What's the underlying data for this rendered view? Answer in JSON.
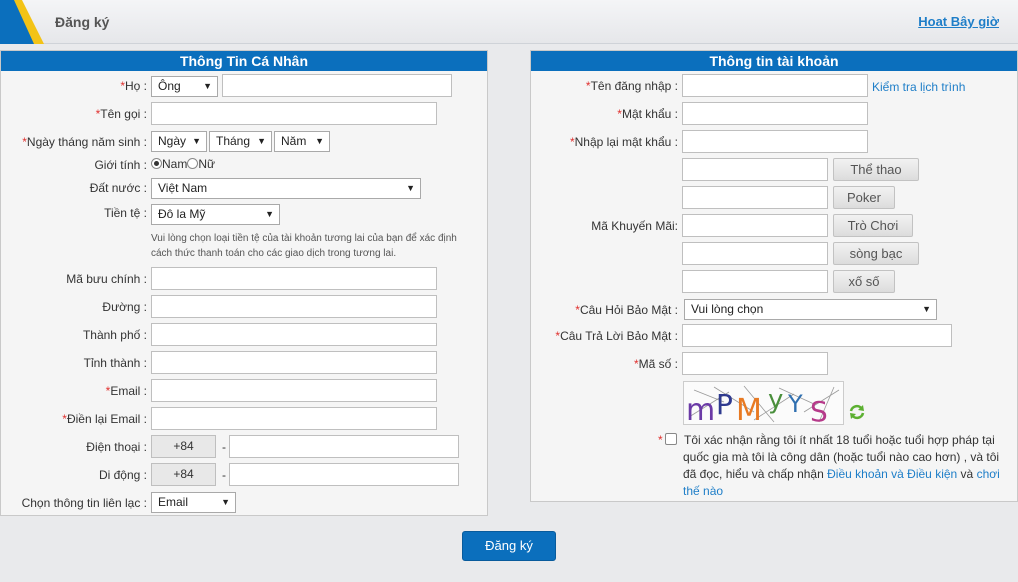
{
  "header": {
    "title": "Đăng ký",
    "login_link": "Hoat Bây giờ"
  },
  "personal": {
    "heading": "Thông Tin Cá Nhân",
    "ho_label": "Họ :",
    "ho_select": "Ông",
    "ten_goi_label": "Tên gọi :",
    "dob_label": "Ngày tháng năm sinh :",
    "dob_day": "Ngày",
    "dob_month": "Tháng",
    "dob_year": "Năm",
    "gender_label": "Giới tính :",
    "gender_male": "Nam",
    "gender_female": "Nữ",
    "country_label": "Đất nước :",
    "country_value": "Việt Nam",
    "currency_label": "Tiền tệ :",
    "currency_value": "Đô la Mỹ",
    "currency_hint": "Vui lòng chọn loại tiền tệ của tài khoản tương lai của bạn để xác định cách thức thanh toán cho các giao dịch trong tương lai.",
    "postal_label": "Mã bưu chính :",
    "street_label": "Đường :",
    "city_label": "Thành phố :",
    "province_label": "Tỉnh thành :",
    "email_label": "Email :",
    "email_confirm_label": "Điền lại Email :",
    "phone_label": "Điện thoại :",
    "phone_code": "+84",
    "mobile_label": "Di động :",
    "mobile_code": "+84",
    "dash": "-",
    "contact_label": "Chọn thông tin liên lạc :",
    "contact_value": "Email"
  },
  "account": {
    "heading": "Thông tin tài khoản",
    "username_label": "Tên đăng nhập :",
    "check_link": "Kiểm tra lịch trình",
    "password_label": "Mật khẩu :",
    "password_confirm_label": "Nhập lại mật khẩu :",
    "promo_label": "Mã Khuyến Mãi:",
    "promo_buttons": [
      "Thể thao",
      "Poker",
      "Trò Chơi",
      "sòng bạc",
      "xố số"
    ],
    "security_q_label": "Câu Hỏi Bảo Mật :",
    "security_q_value": "Vui lòng chọn",
    "security_a_label": "Câu Trả Lời Bảo Mật :",
    "code_label": "Mã số :",
    "captcha_text": "mPMyYS",
    "terms_text": "Tôi xác nhận rằng tôi ít nhất 18 tuổi hoặc tuổi hợp pháp tại quốc gia mà tôi là công dân (hoặc tuổi nào cao hơn) , và tôi đã đọc, hiểu và chấp nhận",
    "terms_link": "Điều khoản và Điều kiện",
    "terms_and": "và",
    "play_link": "chơi thế nào"
  },
  "submit_label": "Đăng ký",
  "colors": {
    "header_blue": "#0b6fbd",
    "link_blue": "#1e7ec8",
    "required_red": "#e0302e"
  }
}
